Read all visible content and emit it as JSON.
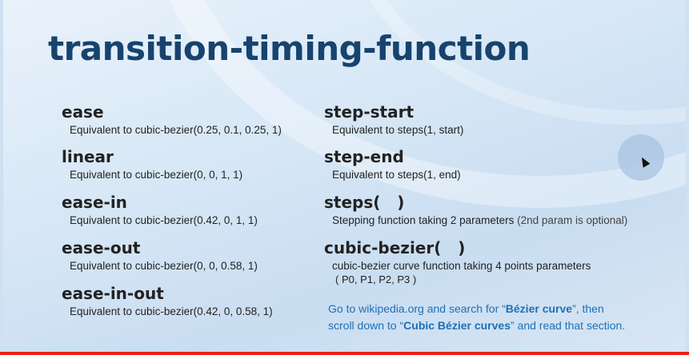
{
  "slide": {
    "title": "transition-timing-function",
    "left_items": [
      {
        "keyword": "ease",
        "description": "Equivalent to cubic-bezier(0.25, 0.1, 0.25, 1)"
      },
      {
        "keyword": "linear",
        "description": "Equivalent to cubic-bezier(0, 0, 1, 1)"
      },
      {
        "keyword": "ease-in",
        "description": "Equivalent to cubic-bezier(0.42, 0, 1, 1)"
      },
      {
        "keyword": "ease-out",
        "description": "Equivalent to cubic-bezier(0, 0, 0.58, 1)"
      },
      {
        "keyword": "ease-in-out",
        "description": "Equivalent to cubic-bezier(0.42, 0, 0.58, 1)"
      }
    ],
    "right_items": [
      {
        "keyword": "step-start",
        "description": "Equivalent to steps(1, start)"
      },
      {
        "keyword": "step-end",
        "description": "Equivalent to steps(1, end)"
      },
      {
        "keyword": "steps(   )",
        "description": "Stepping function taking 2 parameters",
        "description_note": "(2nd param is optional)"
      },
      {
        "keyword": "cubic-bezier(   )",
        "description": "cubic-bezier curve function taking 4 points parameters",
        "points": "( P0, P1, P2, P3 )"
      }
    ],
    "note": {
      "line1_prefix": "Go to wikipedia.org and search for “",
      "line1_bold": "Bézier curve",
      "line1_suffix": "”, then",
      "line2_prefix": "scroll down to “",
      "line2_bold": "Cubic Bézier curves",
      "line2_suffix": "” and read that section."
    }
  },
  "player": {
    "progress_fraction": 1.0,
    "progress_color": "#e62117"
  },
  "colors": {
    "title": "#17436e",
    "note": "#1f6fb4"
  }
}
